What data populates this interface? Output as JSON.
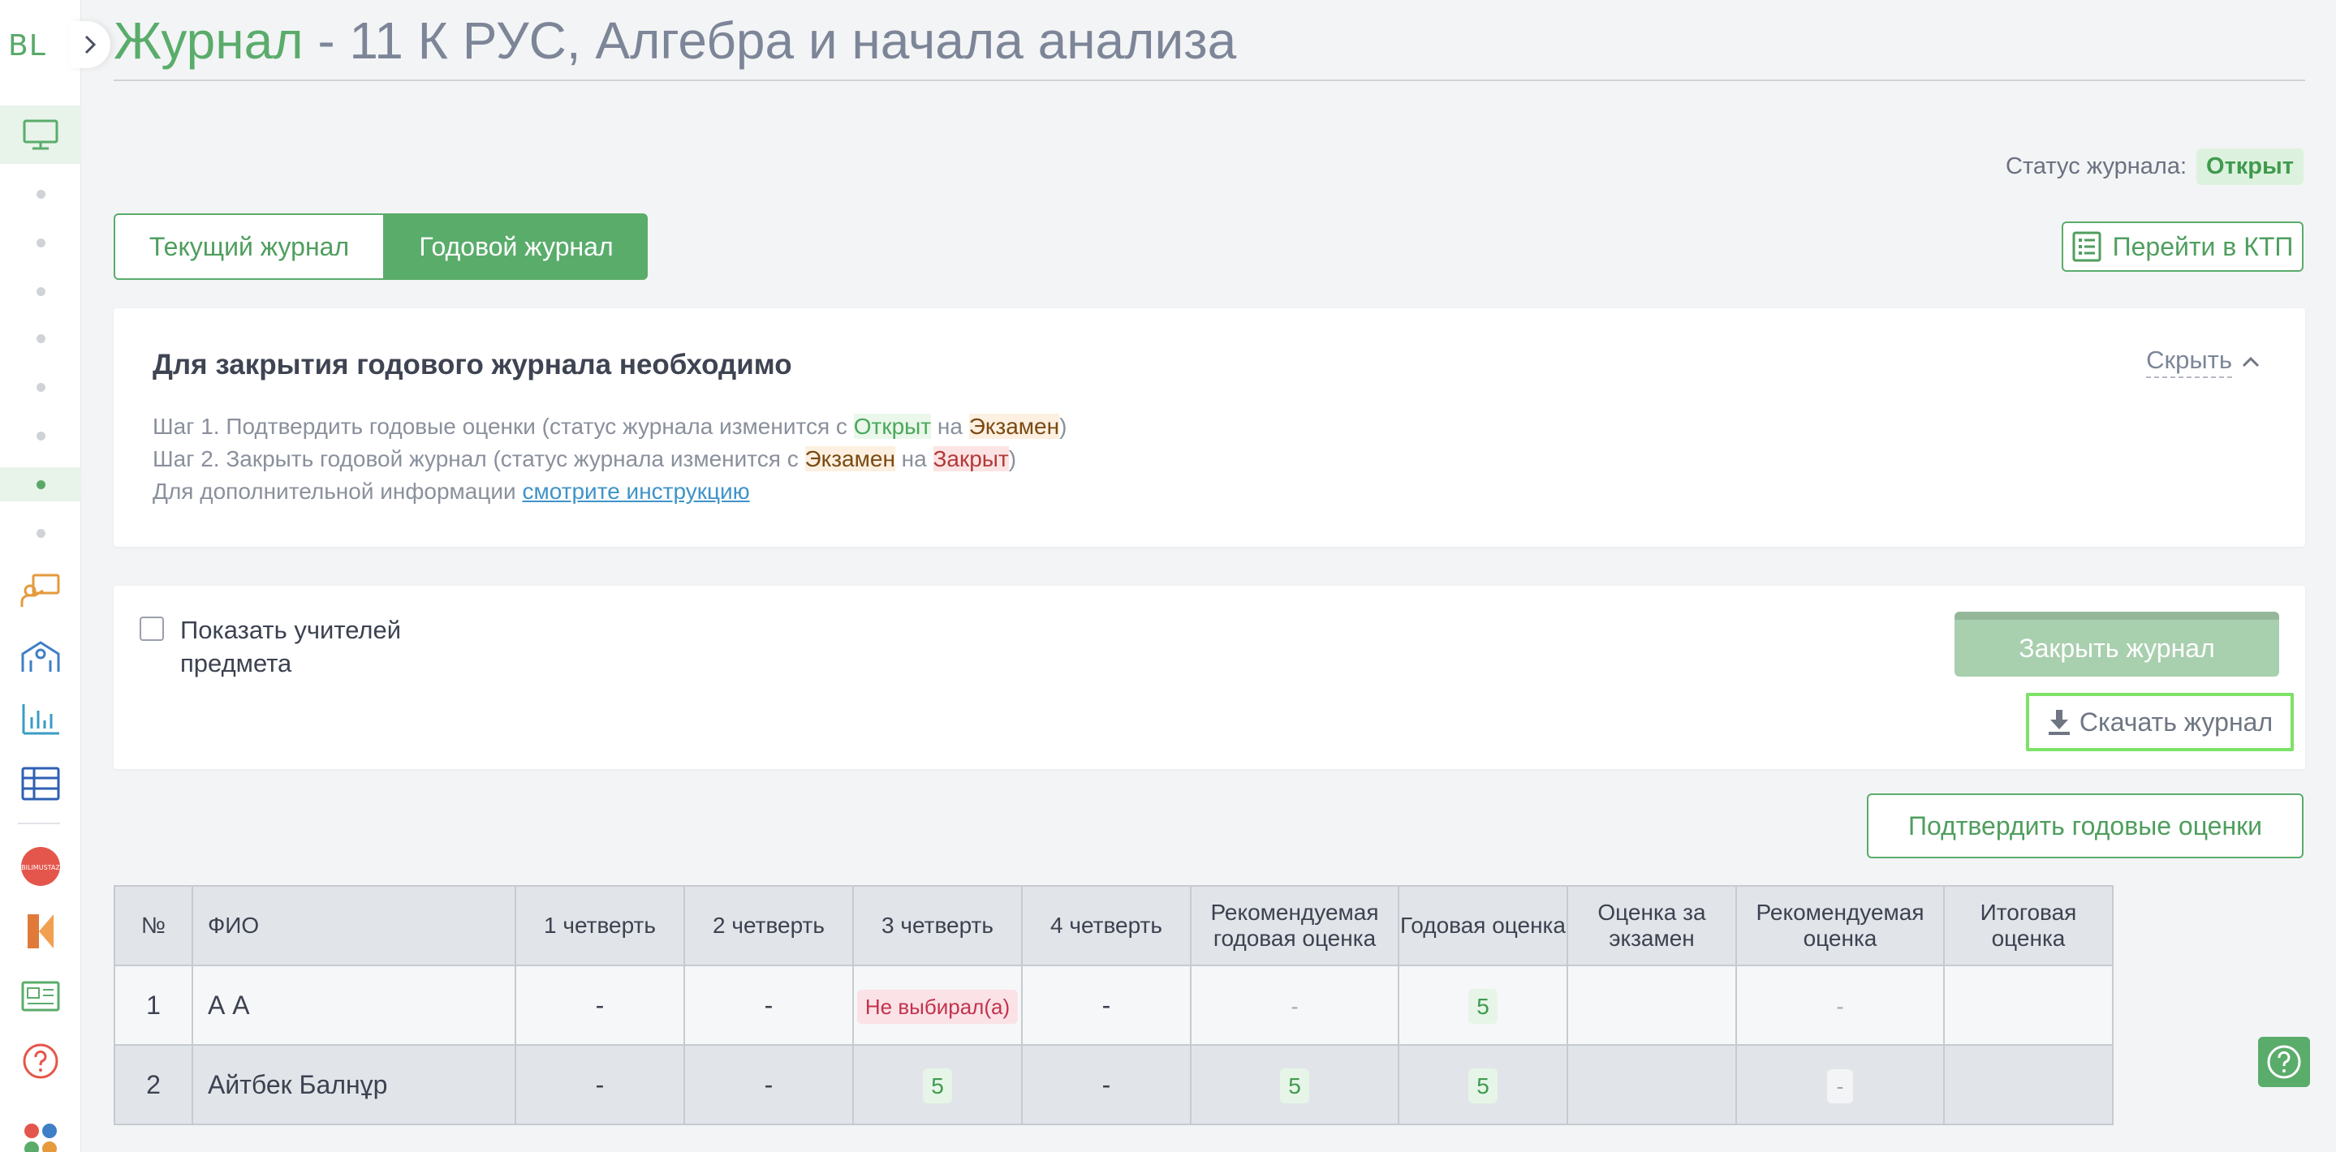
{
  "sidebar": {
    "logo": "BL",
    "ustaz_badge": "BILIMUSTAZ"
  },
  "header": {
    "title_prefix": "Журнал",
    "title_rest": " - 11 К РУС, Алгебра и начала анализа",
    "status_label": "Статус журнала:",
    "status_value": "Открыт"
  },
  "tabs": {
    "current": "Текущий журнал",
    "yearly": "Годовой журнал"
  },
  "ktp_button": "Перейти в КТП",
  "info": {
    "title": "Для закрытия годового журнала необходимо",
    "hide": "Скрыть",
    "step1_a": "Шаг 1. Подтвердить годовые оценки (статус журнала изменится с ",
    "step1_open": "Открыт",
    "step1_b": " на ",
    "step1_exam": "Экзамен",
    "step1_c": ")",
    "step2_a": "Шаг 2. Закрыть годовой журнал (статус журнала изменится с ",
    "step2_exam": "Экзамен",
    "step2_b": " на ",
    "step2_closed": "Закрыт",
    "step2_c": ")",
    "more_a": "Для дополнительной информации ",
    "more_link": "смотрите инструкцию"
  },
  "controls": {
    "show_teachers": "Показать учителей предмета",
    "close_journal": "Закрыть журнал",
    "download_journal": "Скачать журнал"
  },
  "confirm_button": "Подтвердить годовые оценки",
  "table": {
    "headers": [
      "№",
      "ФИО",
      "1 четверть",
      "2 четверть",
      "3 четверть",
      "4 четверть",
      "Рекомендуемая годовая оценка",
      "Годовая оценка",
      "Оценка за экзамен",
      "Рекомендуемая оценка",
      "Итоговая оценка"
    ],
    "rows": [
      {
        "num": "1",
        "name": "А А",
        "q1": "-",
        "q2": "-",
        "q3": "Не выбирал(а)",
        "q4": "-",
        "rec_year": "-",
        "year": "5",
        "exam": "",
        "rec": "-",
        "final": ""
      },
      {
        "num": "2",
        "name": "Айтбек Балнұр",
        "q1": "-",
        "q2": "-",
        "q3": "5",
        "q4": "-",
        "rec_year": "5",
        "year": "5",
        "exam": "",
        "rec": "-",
        "final": ""
      }
    ]
  },
  "colors": {
    "accent": "#5aac6b",
    "status_bg": "#ddf2de",
    "download_highlight": "#7de267"
  }
}
